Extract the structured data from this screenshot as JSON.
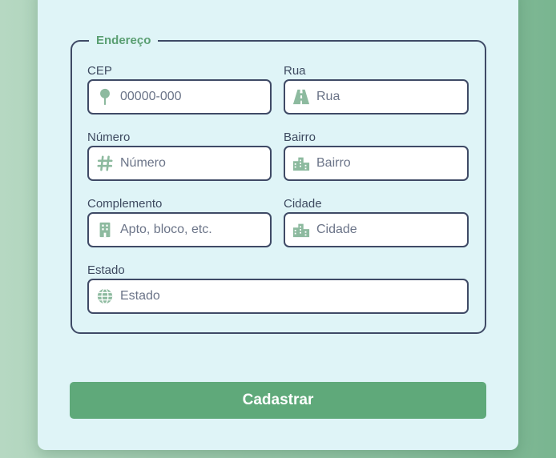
{
  "address_section": {
    "legend": "Endereço",
    "fields": {
      "cep": {
        "label": "CEP",
        "placeholder": "00000-000",
        "value": "",
        "icon": "map-pin-icon"
      },
      "rua": {
        "label": "Rua",
        "placeholder": "Rua",
        "value": "",
        "icon": "road-icon"
      },
      "numero": {
        "label": "Número",
        "placeholder": "Número",
        "value": "",
        "icon": "hashtag-icon"
      },
      "bairro": {
        "label": "Bairro",
        "placeholder": "Bairro",
        "value": "",
        "icon": "city-icon"
      },
      "complemento": {
        "label": "Complemento",
        "placeholder": "Apto, bloco, etc.",
        "value": "",
        "icon": "building-icon"
      },
      "cidade": {
        "label": "Cidade",
        "placeholder": "Cidade",
        "value": "",
        "icon": "city-icon"
      },
      "estado": {
        "label": "Estado",
        "placeholder": "Estado",
        "value": "",
        "icon": "globe-icon"
      }
    }
  },
  "submit_label": "Cadastrar",
  "colors": {
    "accent": "#5fa97a",
    "icon": "#8dba9f",
    "card_background": "#dff4f7",
    "border": "#3f4a66",
    "text": "#3e4a60"
  }
}
